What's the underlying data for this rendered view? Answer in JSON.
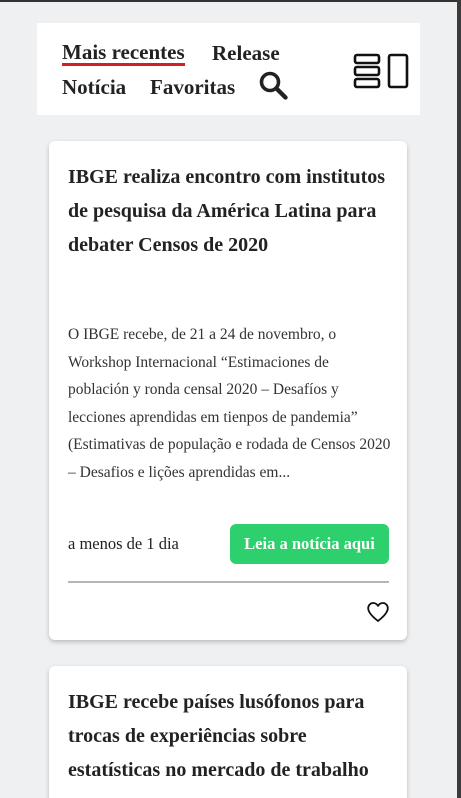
{
  "nav": {
    "items": [
      {
        "label": "Mais recentes",
        "active": true
      },
      {
        "label": "Release",
        "active": false
      },
      {
        "label": "Notícia",
        "active": false
      },
      {
        "label": "Favoritas",
        "active": false
      }
    ],
    "search_icon": "search-icon",
    "layout_icon": "layout-toggle-icon",
    "active_underline_color": "#d21f1f"
  },
  "news": [
    {
      "title": "IBGE realiza encontro com institutos de pesquisa da América Latina para debater Censos de 2020",
      "excerpt": "O IBGE recebe, de 21 a 24 de novembro, o Workshop Internacional “Estimaciones de población y ronda censal 2020 – Desafíos y lecciones aprendidas em tienpos de pandemia” (Estimativas de população e rodada de Censos 2020 – Desafios e lições aprendidas em...",
      "time": "a menos de 1 dia",
      "button": "Leia a notícia aqui",
      "favorite_icon": "heart-outline-icon"
    },
    {
      "title": "IBGE recebe países lusófonos para trocas de experiências sobre estatísticas no mercado de trabalho"
    }
  ],
  "colors": {
    "background": "#eff0f2",
    "card": "#ffffff",
    "button": "#2ed06e"
  }
}
